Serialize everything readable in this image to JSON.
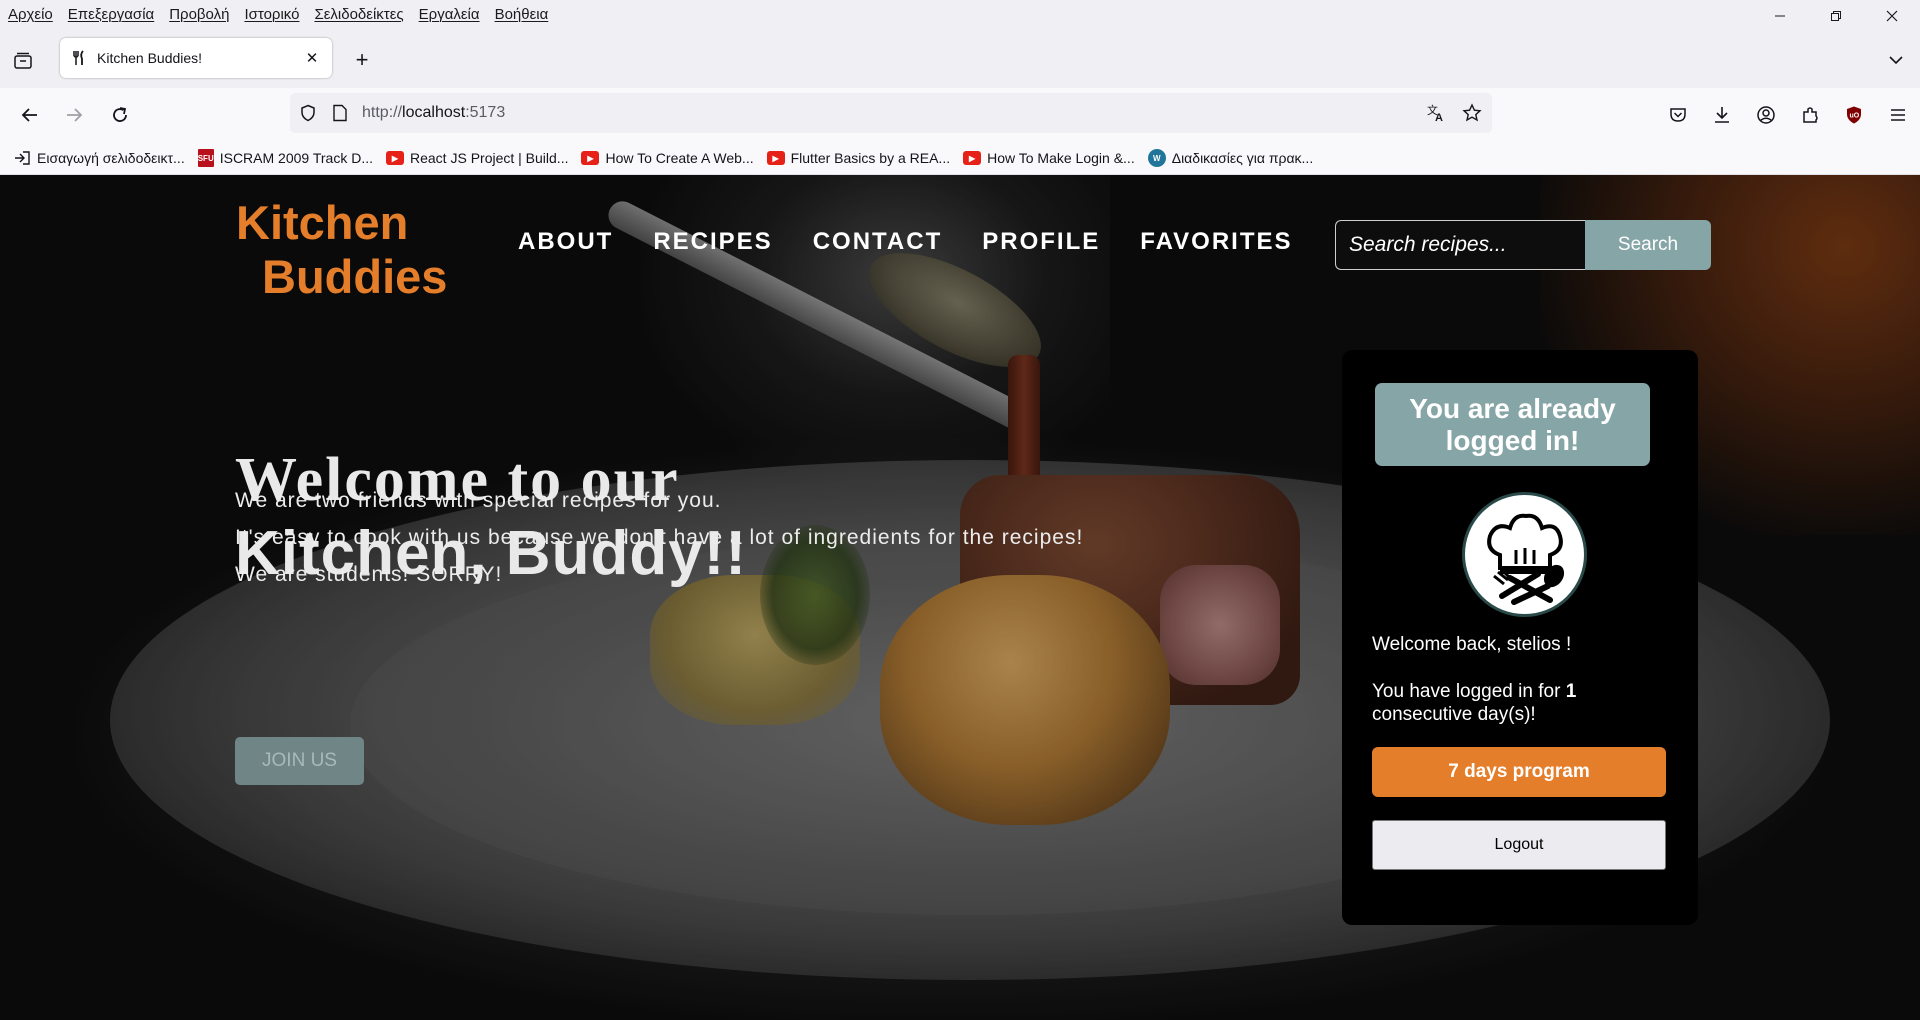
{
  "browser": {
    "menu": [
      "Αρχείο",
      "Επεξεργασία",
      "Προβολή",
      "Ιστορικό",
      "Σελιδοδείκτες",
      "Εργαλεία",
      "Βοήθεια"
    ],
    "tab": {
      "title": "Kitchen Buddies!",
      "icon": "fork-knife-icon"
    },
    "url": {
      "scheme": "http://",
      "host": "localhost",
      "port": ":5173"
    },
    "bookmarks": [
      {
        "label": "Εισαγωγή σελιδοδεικτ...",
        "icon": "import-icon"
      },
      {
        "label": "ISCRAM 2009 Track D...",
        "icon": "sfu-icon"
      },
      {
        "label": "React JS Project | Build...",
        "icon": "youtube-icon"
      },
      {
        "label": "How To Create A Web...",
        "icon": "youtube-icon"
      },
      {
        "label": "Flutter Basics by a REA...",
        "icon": "youtube-icon"
      },
      {
        "label": "How To Make Login &...",
        "icon": "youtube-icon"
      },
      {
        "label": "Διαδικασίες για πρακ...",
        "icon": "wordpress-icon"
      }
    ]
  },
  "site": {
    "logo": {
      "line1": "Kitchen",
      "line2": "Buddies"
    },
    "nav": [
      "ABOUT",
      "RECIPES",
      "CONTACT",
      "PROFILE",
      "FAVORITES"
    ],
    "search": {
      "placeholder": "Search recipes...",
      "button": "Search"
    },
    "hero": {
      "title_line1": "Welcome to our",
      "title_line2": "Kitchen, Buddy!!",
      "lines": [
        "We are two friends with special recipes for you.",
        "It's easy to cook with us because we don't have a lot of ingredients for the recipes!",
        "We are students! SORRY!"
      ],
      "join_button": "JOIN US"
    },
    "card": {
      "header": "You are already logged in!",
      "avatar_icon": "chef-hat-icon",
      "welcome": "Welcome back, stelios !",
      "streak_prefix": "You have logged in for",
      "streak_days": "1",
      "streak_suffix": "consecutive day(s)!",
      "program_button": "7 days program",
      "logout_button": "Logout"
    },
    "colors": {
      "accent": "#e57e2a",
      "teal": "#86a5a6"
    }
  }
}
